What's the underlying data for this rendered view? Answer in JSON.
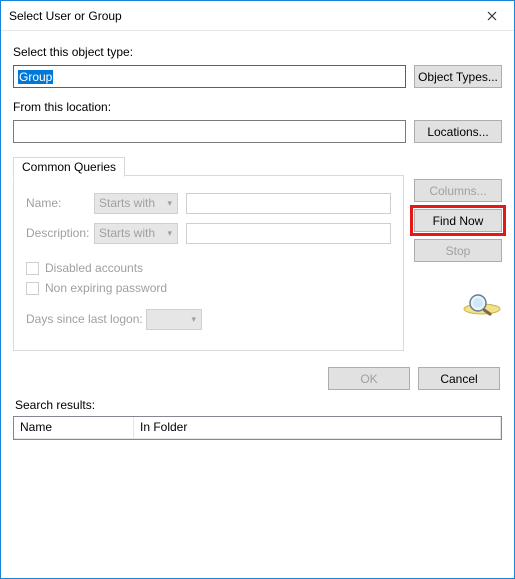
{
  "window": {
    "title": "Select User or Group"
  },
  "objectType": {
    "label": "Select this object type:",
    "value": "Group",
    "button": "Object Types..."
  },
  "location": {
    "label": "From this location:",
    "value": "",
    "button": "Locations..."
  },
  "tab": {
    "label": "Common Queries"
  },
  "queries": {
    "nameLabel": "Name:",
    "nameMode": "Starts with",
    "descLabel": "Description:",
    "descMode": "Starts with",
    "disabledAccounts": "Disabled accounts",
    "nonExpiring": "Non expiring password",
    "daysSince": "Days since last logon:"
  },
  "sideButtons": {
    "columns": "Columns...",
    "findNow": "Find Now",
    "stop": "Stop"
  },
  "footer": {
    "ok": "OK",
    "cancel": "Cancel"
  },
  "results": {
    "label": "Search results:",
    "col1": "Name",
    "col2": "In Folder"
  }
}
